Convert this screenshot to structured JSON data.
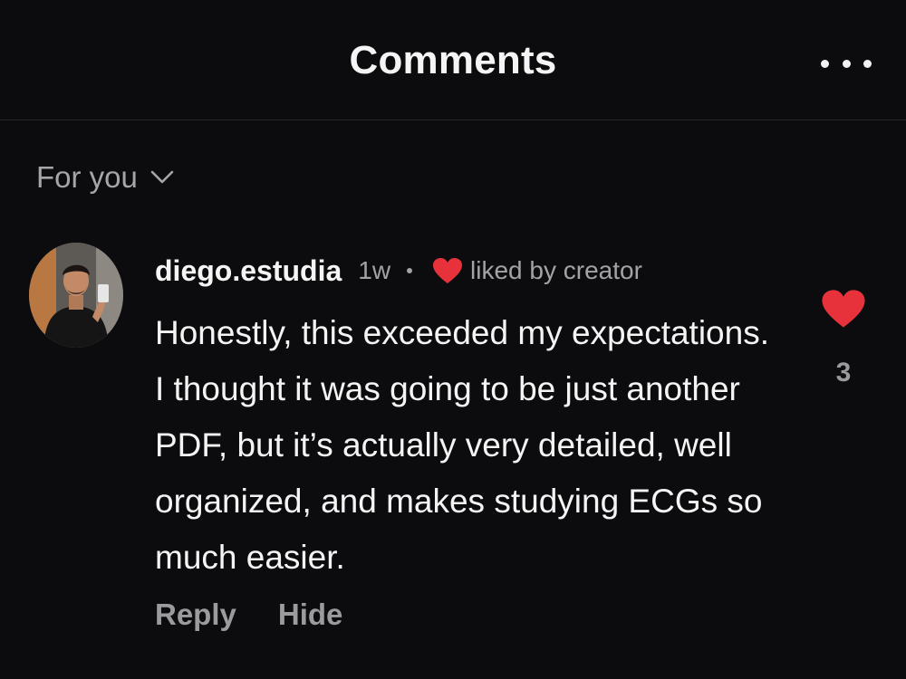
{
  "header": {
    "title": "Comments",
    "more_icon": "more-horizontal-icon"
  },
  "sort": {
    "label": "For you",
    "icon": "chevron-down-icon"
  },
  "comment": {
    "username": "diego.estudia",
    "time": "1w",
    "liked_by_creator_label": "liked by creator",
    "body_lines": [
      "Honestly, this exceeded my expectations.",
      "I thought it was going to be just another",
      "PDF, but it’s actually very detailed, well",
      "organized, and makes studying ECGs so",
      "much easier."
    ],
    "actions": {
      "reply": "Reply",
      "hide": "Hide"
    },
    "like_count": "3",
    "like_icon": "heart-icon",
    "like_color": "#e8323b"
  },
  "colors": {
    "background": "#0c0c0e",
    "primary_text": "#f4f4f4",
    "secondary_text": "#a3a3a6",
    "heart": "#e8323b"
  }
}
